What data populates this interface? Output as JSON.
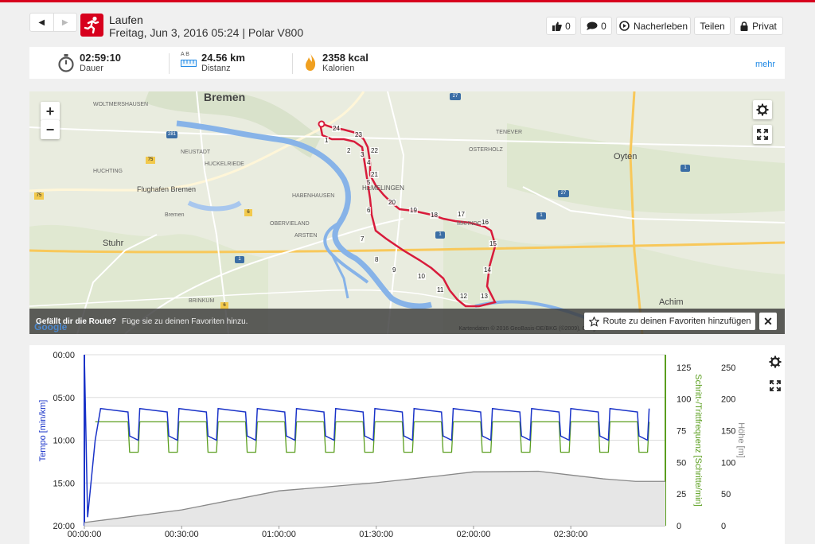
{
  "nav": {
    "back_icon": "chevron-left-icon",
    "forward_icon": "chevron-right-icon"
  },
  "activity": {
    "sport": "Laufen",
    "date_device": "Freitag, Jun 3, 2016 05:24 | Polar V800",
    "sport_icon": "running-person-icon"
  },
  "actions": {
    "likes": "0",
    "comments": "0",
    "replay": "Nacherleben",
    "share": "Teilen",
    "privacy": "Privat"
  },
  "stats": {
    "duration": {
      "value": "02:59:10",
      "label": "Dauer"
    },
    "distance": {
      "value": "24.56 km",
      "label": "Distanz",
      "ab": "A B"
    },
    "calories": {
      "value": "2358 kcal",
      "label": "Kalorien"
    },
    "more": "mehr"
  },
  "map": {
    "banner_question": "Gefällt dir die Route?",
    "banner_text": "Füge sie zu deinen Favoriten hinzu.",
    "fav_button": "Route zu deinen Favoriten hinzufügen",
    "attribution": "Kartendaten © 2016 GeoBasis-DE/BKG (©2009), Google",
    "google": "Google",
    "zoom_in": "+",
    "zoom_out": "−",
    "city": "Bremen",
    "labels": [
      "WOLTMERSHAUSEN",
      "NEUSTADT",
      "HUCKELRIEDE",
      "HUCHTING",
      "Flughafen Bremen",
      "HABENHAUSEN",
      "OBERVIELAND",
      "ARSTEN",
      "BRINKUM",
      "Stuhr",
      "HEMELINGEN",
      "MAHNDORF",
      "OSTERHOLZ",
      "TENEVER",
      "Oyten",
      "Achim",
      "Bremen"
    ],
    "markers": [
      "1",
      "2",
      "3",
      "4",
      "5",
      "6",
      "7",
      "8",
      "9",
      "10",
      "11",
      "12",
      "13",
      "14",
      "15",
      "16",
      "17",
      "18",
      "19",
      "20",
      "21",
      "22",
      "23",
      "24"
    ],
    "road_badges": [
      "281",
      "75",
      "75",
      "6",
      "6",
      "27",
      "27",
      "1",
      "1",
      "1",
      "1"
    ]
  },
  "chart_data": {
    "type": "line",
    "xlabel": "",
    "x_ticks": [
      "00:00:00",
      "00:30:00",
      "01:00:00",
      "01:30:00",
      "02:00:00",
      "02:30:00"
    ],
    "x_tick_seconds": [
      0,
      1800,
      3600,
      5400,
      7200,
      9000
    ],
    "duration_s": 10750,
    "axes": {
      "tempo": {
        "label": "Tempo [min/km]",
        "ticks": [
          "00:00",
          "05:00",
          "10:00",
          "15:00",
          "20:00"
        ],
        "range_min": [
          0,
          20
        ],
        "color": "#1a33c8"
      },
      "cadence": {
        "label": "Schritt-/Trittfrequenz [Schritte/min]",
        "ticks": [
          "0",
          "25",
          "50",
          "75",
          "100",
          "125"
        ],
        "range": [
          0,
          135
        ],
        "color": "#5a9e1e"
      },
      "altitude": {
        "label": "Höhe [m]",
        "ticks": [
          "0",
          "50",
          "100",
          "150",
          "200",
          "250"
        ],
        "range": [
          0,
          270
        ],
        "color": "#888888"
      }
    },
    "series": [
      {
        "name": "Tempo [min/km]",
        "axis": "tempo",
        "fast_min": 6.3,
        "slow_min": 9.5,
        "intervals": 14
      },
      {
        "name": "Schritt-/Trittfrequenz [Schritte/min]",
        "axis": "cadence",
        "high": 82,
        "low": 58
      },
      {
        "name": "Höhe [m]",
        "axis": "altitude",
        "points": [
          [
            0,
            5
          ],
          [
            1800,
            25
          ],
          [
            3600,
            55
          ],
          [
            4300,
            60
          ],
          [
            5400,
            68
          ],
          [
            6500,
            78
          ],
          [
            7200,
            85
          ],
          [
            8400,
            86
          ],
          [
            9000,
            80
          ],
          [
            9600,
            74
          ],
          [
            10200,
            70
          ],
          [
            10750,
            70
          ]
        ]
      }
    ]
  }
}
